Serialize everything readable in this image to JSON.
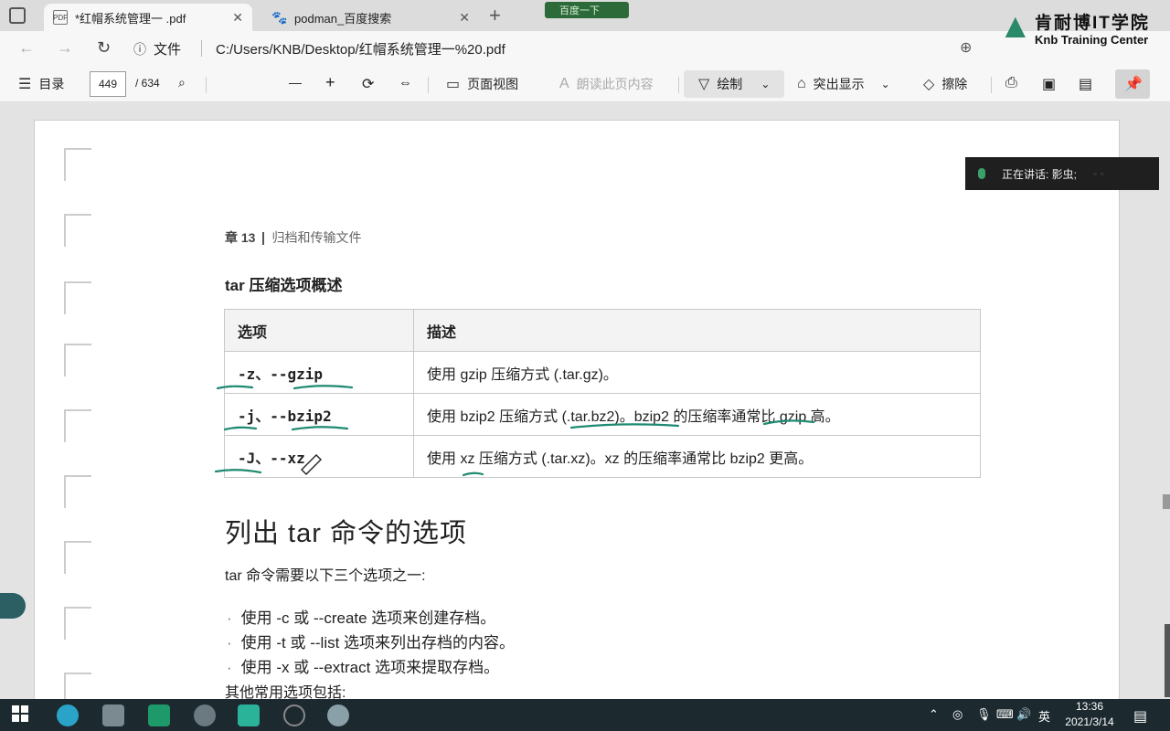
{
  "tabs": [
    {
      "label": "*红帽系统管理一 .pdf",
      "active": true,
      "favicon": "pdf-icon"
    },
    {
      "label": "podman_百度搜索",
      "active": false,
      "favicon": "baidu-paw-icon"
    }
  ],
  "recording_badge": "百度一下",
  "address": {
    "scheme_label": "文件",
    "url": "C:/Users/KNB/Desktop/红帽系统管理一%20.pdf"
  },
  "logo": {
    "name_cn": "肯耐博IT学院",
    "name_en": "Knb Training Center"
  },
  "toolbar": {
    "toc_label": "目录",
    "page_current": "449",
    "page_total": "/ 634",
    "page_view_label": "页面视图",
    "read_aloud_label": "朗读此页内容",
    "draw_label": "绘制",
    "highlight_label": "突出显示",
    "erase_label": "擦除"
  },
  "doc": {
    "chapter_num": "章 13",
    "chapter_title": "归档和传输文件",
    "section_title": "tar 压缩选项概述",
    "table": {
      "headers": [
        "选项",
        "描述"
      ],
      "rows": [
        {
          "option": "-z、--gzip",
          "desc": "使用 gzip 压缩方式 (.tar.gz)。"
        },
        {
          "option": "-j、--bzip2",
          "desc": "使用 bzip2 压缩方式 (.tar.bz2)。bzip2 的压缩率通常比 gzip 高。"
        },
        {
          "option": "-J、--xz",
          "desc": "使用 xz 压缩方式 (.tar.xz)。xz 的压缩率通常比 bzip2 更高。"
        }
      ]
    },
    "heading2": "列出 tar 命令的选项",
    "intro": "tar 命令需要以下三个选项之一:",
    "bullets": [
      "使用 -c 或 --create 选项来创建存档。",
      "使用 -t 或 --list 选项来列出存档的内容。",
      "使用 -x 或 --extract 选项来提取存档。"
    ],
    "more_text": "其他常用选项包括:"
  },
  "notification": {
    "text": "正在讲话: 影虫;"
  },
  "taskbar": {
    "ime": "英",
    "time": "13:36",
    "date": "2021/3/14"
  }
}
